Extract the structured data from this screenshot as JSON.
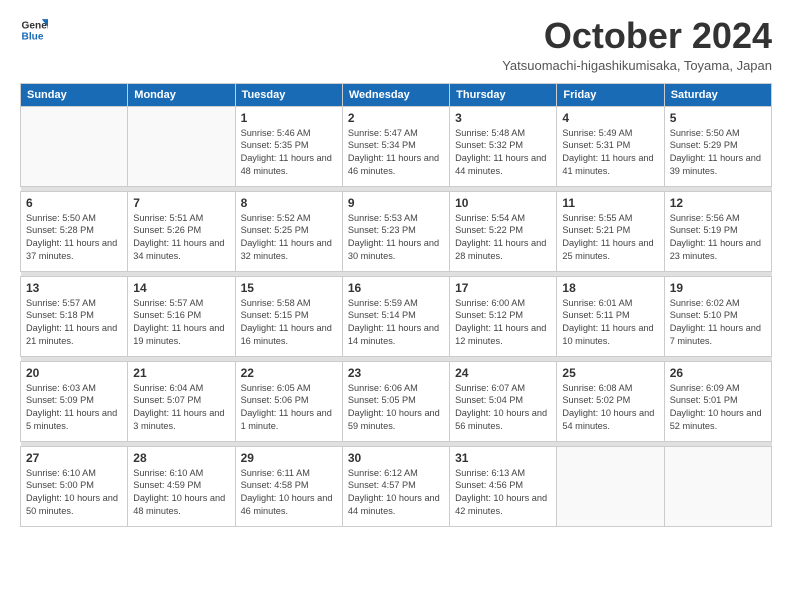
{
  "logo": {
    "line1": "General",
    "line2": "Blue"
  },
  "title": "October 2024",
  "subtitle": "Yatsuomachi-higashikumisaka, Toyama, Japan",
  "weekdays": [
    "Sunday",
    "Monday",
    "Tuesday",
    "Wednesday",
    "Thursday",
    "Friday",
    "Saturday"
  ],
  "weeks": [
    [
      {
        "day": "",
        "info": ""
      },
      {
        "day": "",
        "info": ""
      },
      {
        "day": "1",
        "info": "Sunrise: 5:46 AM\nSunset: 5:35 PM\nDaylight: 11 hours and 48 minutes."
      },
      {
        "day": "2",
        "info": "Sunrise: 5:47 AM\nSunset: 5:34 PM\nDaylight: 11 hours and 46 minutes."
      },
      {
        "day": "3",
        "info": "Sunrise: 5:48 AM\nSunset: 5:32 PM\nDaylight: 11 hours and 44 minutes."
      },
      {
        "day": "4",
        "info": "Sunrise: 5:49 AM\nSunset: 5:31 PM\nDaylight: 11 hours and 41 minutes."
      },
      {
        "day": "5",
        "info": "Sunrise: 5:50 AM\nSunset: 5:29 PM\nDaylight: 11 hours and 39 minutes."
      }
    ],
    [
      {
        "day": "6",
        "info": "Sunrise: 5:50 AM\nSunset: 5:28 PM\nDaylight: 11 hours and 37 minutes."
      },
      {
        "day": "7",
        "info": "Sunrise: 5:51 AM\nSunset: 5:26 PM\nDaylight: 11 hours and 34 minutes."
      },
      {
        "day": "8",
        "info": "Sunrise: 5:52 AM\nSunset: 5:25 PM\nDaylight: 11 hours and 32 minutes."
      },
      {
        "day": "9",
        "info": "Sunrise: 5:53 AM\nSunset: 5:23 PM\nDaylight: 11 hours and 30 minutes."
      },
      {
        "day": "10",
        "info": "Sunrise: 5:54 AM\nSunset: 5:22 PM\nDaylight: 11 hours and 28 minutes."
      },
      {
        "day": "11",
        "info": "Sunrise: 5:55 AM\nSunset: 5:21 PM\nDaylight: 11 hours and 25 minutes."
      },
      {
        "day": "12",
        "info": "Sunrise: 5:56 AM\nSunset: 5:19 PM\nDaylight: 11 hours and 23 minutes."
      }
    ],
    [
      {
        "day": "13",
        "info": "Sunrise: 5:57 AM\nSunset: 5:18 PM\nDaylight: 11 hours and 21 minutes."
      },
      {
        "day": "14",
        "info": "Sunrise: 5:57 AM\nSunset: 5:16 PM\nDaylight: 11 hours and 19 minutes."
      },
      {
        "day": "15",
        "info": "Sunrise: 5:58 AM\nSunset: 5:15 PM\nDaylight: 11 hours and 16 minutes."
      },
      {
        "day": "16",
        "info": "Sunrise: 5:59 AM\nSunset: 5:14 PM\nDaylight: 11 hours and 14 minutes."
      },
      {
        "day": "17",
        "info": "Sunrise: 6:00 AM\nSunset: 5:12 PM\nDaylight: 11 hours and 12 minutes."
      },
      {
        "day": "18",
        "info": "Sunrise: 6:01 AM\nSunset: 5:11 PM\nDaylight: 11 hours and 10 minutes."
      },
      {
        "day": "19",
        "info": "Sunrise: 6:02 AM\nSunset: 5:10 PM\nDaylight: 11 hours and 7 minutes."
      }
    ],
    [
      {
        "day": "20",
        "info": "Sunrise: 6:03 AM\nSunset: 5:09 PM\nDaylight: 11 hours and 5 minutes."
      },
      {
        "day": "21",
        "info": "Sunrise: 6:04 AM\nSunset: 5:07 PM\nDaylight: 11 hours and 3 minutes."
      },
      {
        "day": "22",
        "info": "Sunrise: 6:05 AM\nSunset: 5:06 PM\nDaylight: 11 hours and 1 minute."
      },
      {
        "day": "23",
        "info": "Sunrise: 6:06 AM\nSunset: 5:05 PM\nDaylight: 10 hours and 59 minutes."
      },
      {
        "day": "24",
        "info": "Sunrise: 6:07 AM\nSunset: 5:04 PM\nDaylight: 10 hours and 56 minutes."
      },
      {
        "day": "25",
        "info": "Sunrise: 6:08 AM\nSunset: 5:02 PM\nDaylight: 10 hours and 54 minutes."
      },
      {
        "day": "26",
        "info": "Sunrise: 6:09 AM\nSunset: 5:01 PM\nDaylight: 10 hours and 52 minutes."
      }
    ],
    [
      {
        "day": "27",
        "info": "Sunrise: 6:10 AM\nSunset: 5:00 PM\nDaylight: 10 hours and 50 minutes."
      },
      {
        "day": "28",
        "info": "Sunrise: 6:10 AM\nSunset: 4:59 PM\nDaylight: 10 hours and 48 minutes."
      },
      {
        "day": "29",
        "info": "Sunrise: 6:11 AM\nSunset: 4:58 PM\nDaylight: 10 hours and 46 minutes."
      },
      {
        "day": "30",
        "info": "Sunrise: 6:12 AM\nSunset: 4:57 PM\nDaylight: 10 hours and 44 minutes."
      },
      {
        "day": "31",
        "info": "Sunrise: 6:13 AM\nSunset: 4:56 PM\nDaylight: 10 hours and 42 minutes."
      },
      {
        "day": "",
        "info": ""
      },
      {
        "day": "",
        "info": ""
      }
    ]
  ]
}
